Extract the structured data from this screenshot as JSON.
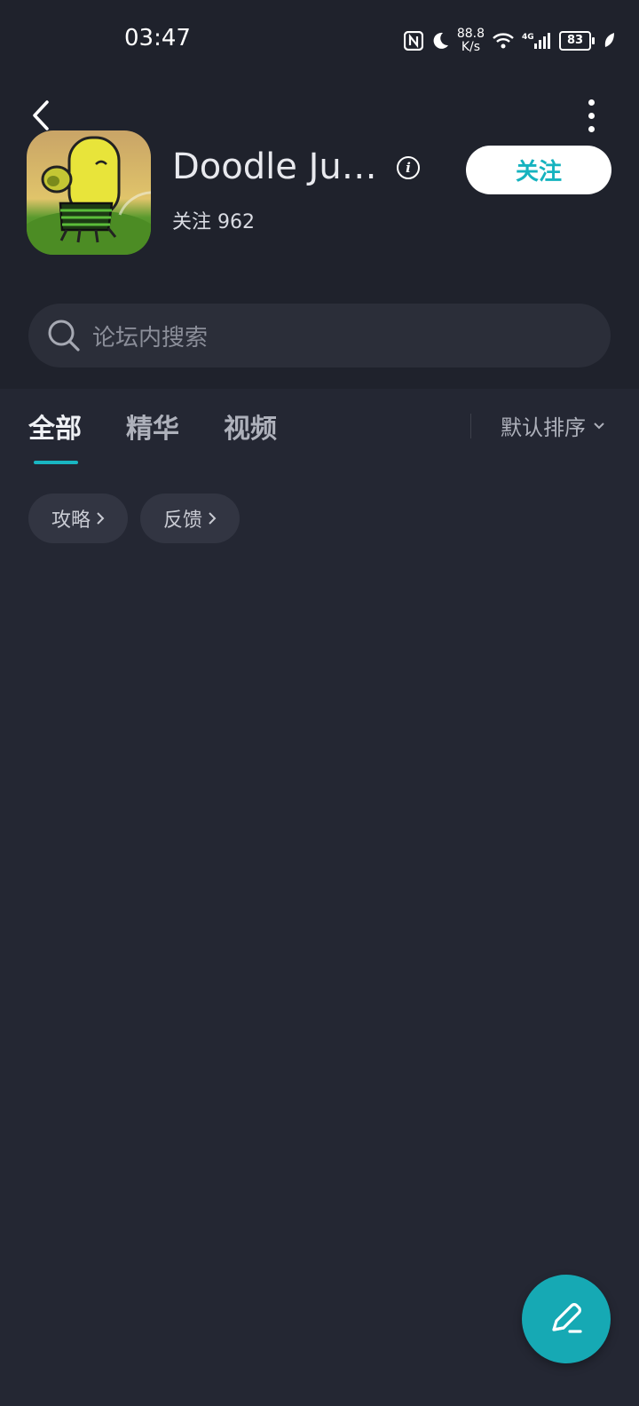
{
  "status_bar": {
    "time": "03:47",
    "net_speed_value": "88.8",
    "net_speed_unit": "K/s",
    "network_type": "4G",
    "battery": "83",
    "icons": [
      "nfc-icon",
      "moon-icon",
      "wifi-icon",
      "signal-icon",
      "battery-icon",
      "leaf-icon"
    ]
  },
  "header": {
    "back_icon": "chevron-left-icon",
    "more_icon": "more-vertical-icon",
    "app_name": "Doodle Ju…",
    "info_icon": "info-icon",
    "follow_label": "关注",
    "follower_label": "关注",
    "follower_count": "962"
  },
  "search": {
    "placeholder": "论坛内搜索",
    "icon": "search-icon"
  },
  "tabs": {
    "items": [
      {
        "label": "全部",
        "active": true
      },
      {
        "label": "精华",
        "active": false
      },
      {
        "label": "视频",
        "active": false
      }
    ],
    "sort_label": "默认排序"
  },
  "chips": [
    {
      "label": "攻略"
    },
    {
      "label": "反馈"
    }
  ],
  "fab": {
    "icon": "pen-icon"
  },
  "colors": {
    "background": "#242733",
    "header_bg": "#1f222c",
    "accent": "#16b3bf",
    "chip_bg": "#323542"
  }
}
